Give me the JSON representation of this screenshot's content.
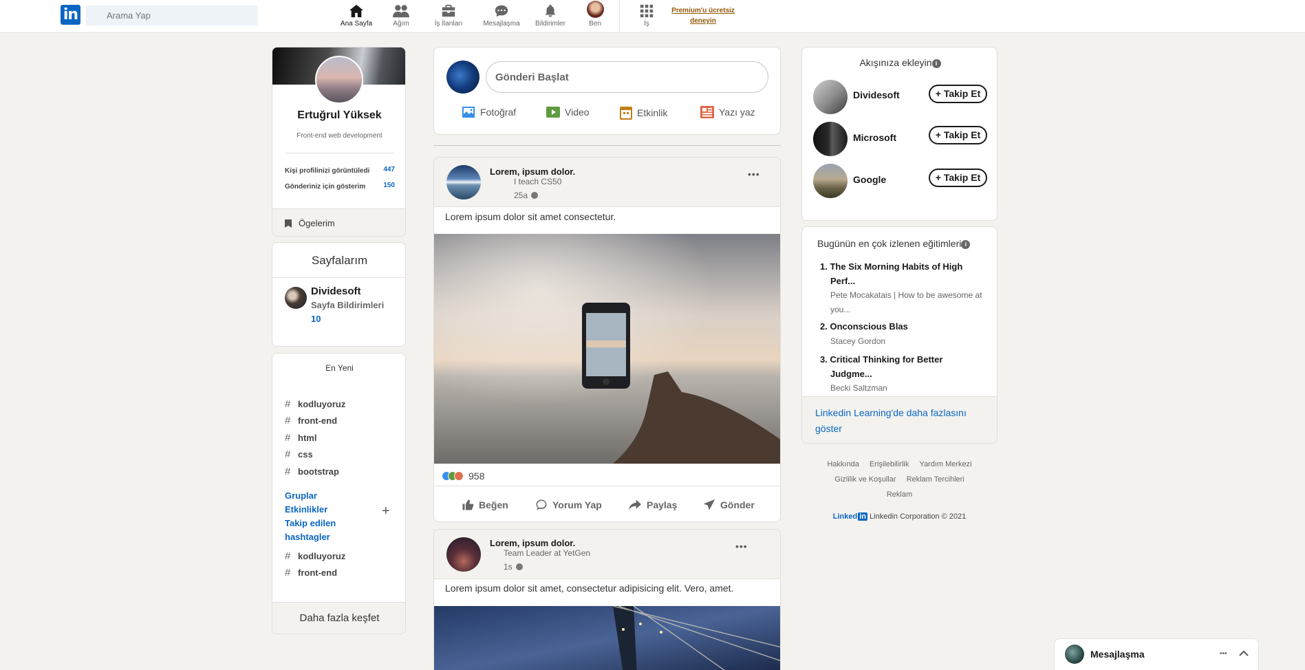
{
  "nav": {
    "search_placeholder": "Arama Yap",
    "items": [
      {
        "label": "Ana Sayfa",
        "icon": "home-icon"
      },
      {
        "label": "Ağım",
        "icon": "network-icon"
      },
      {
        "label": "İş İlanları",
        "icon": "briefcase-icon"
      },
      {
        "label": "Mesajlaşma",
        "icon": "message-icon"
      },
      {
        "label": "Bildirimler",
        "icon": "bell-icon"
      },
      {
        "label": "Ben",
        "icon": "profile-avatar"
      },
      {
        "label": "İş",
        "icon": "grid-icon"
      }
    ],
    "premium_line1": "Premium'u ücretsiz",
    "premium_line2": "deneyin"
  },
  "profile": {
    "name": "Ertuğrul Yüksek",
    "headline": "Front-end web development",
    "stat1_label": "Kişi profilinizi görüntüledi",
    "stat1_value": "447",
    "stat2_label": "Gönderiniz için gösterim",
    "stat2_value": "150",
    "items_label": "Ögelerim"
  },
  "pages": {
    "title": "Sayfalarım",
    "page_name": "Dividesoft",
    "notif_label": "Sayfa Bildirimleri",
    "notif_count": "10"
  },
  "recent": {
    "title": "En Yeni",
    "hashtags": [
      "kodluyoruz",
      "front-end",
      "html",
      "css",
      "bootstrap"
    ],
    "links": [
      "Gruplar",
      "Etkinlikler",
      "Takip edilen",
      "hashtagler"
    ],
    "hashtags2": [
      "kodluyoruz",
      "front-end"
    ],
    "discover": "Daha fazla keşfet"
  },
  "composer": {
    "placeholder": "Gönderi Başlat",
    "actions": [
      "Fotoğraf",
      "Video",
      "Etkinlik",
      "Yazı yaz"
    ]
  },
  "posts": [
    {
      "author": "Lorem, ipsum dolor.",
      "subtitle": "I teach CS50",
      "time": "25a",
      "text": "Lorem ipsum dolor sit amet consectetur.",
      "reactions": "958",
      "actions": [
        "Beğen",
        "Yorum Yap",
        "Paylaş",
        "Gönder"
      ]
    },
    {
      "author": "Lorem, ipsum dolor.",
      "subtitle": "Team Leader at YetGen",
      "time": "1s",
      "text": "Lorem ipsum dolor sit amet, consectetur adipisicing elit. Vero, amet."
    }
  ],
  "follow": {
    "title": "Akışınıza ekleyin",
    "button": "+ Takip Et",
    "companies": [
      "Dividesoft",
      "Microsoft",
      "Google"
    ]
  },
  "courses": {
    "title": "Bugünün en çok izlenen eğitimleri",
    "list": [
      {
        "num": "1.",
        "line1": "The Six Morning Habits of High",
        "line2": "Perf...",
        "author1": "Pete Mocakatais | How to be awesome at",
        "author2": "you..."
      },
      {
        "num": "2.",
        "line1": "Onconscious Blas",
        "line2": "",
        "author1": "Stacey Gordon",
        "author2": ""
      },
      {
        "num": "3.",
        "line1": "Critical Thinking for Better",
        "line2": "Judgme...",
        "author1": "Becki Saltzman",
        "author2": ""
      }
    ],
    "more_line1": "Linkedin Learning'de daha fazlasını",
    "more_line2": "göster"
  },
  "footer": {
    "links": [
      "Hakkında",
      "Erişilebilirlik",
      "Yardım Merkezi",
      "Gizlilik ve Koşullar",
      "Reklam Tercihleri",
      "Reklam"
    ],
    "brand": "Linked",
    "brand_in": "in",
    "copyright": "Linkedin Corporation © 2021"
  },
  "messaging": {
    "title": "Mesajlaşma",
    "more": "•••"
  },
  "colors": {
    "brand": "#0a66c2",
    "premium": "#915907",
    "background": "#f3f2ef"
  }
}
